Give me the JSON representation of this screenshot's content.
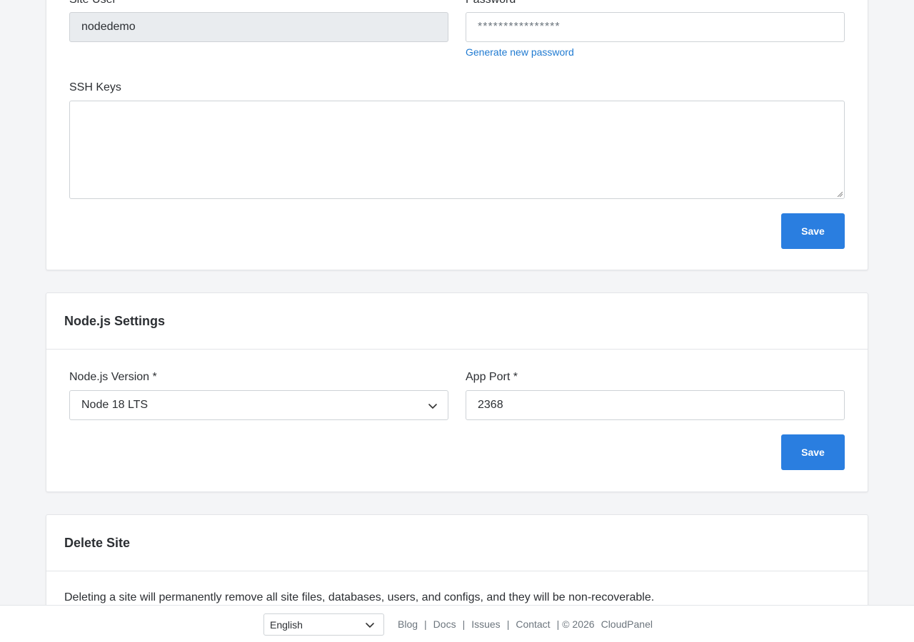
{
  "site_user_section": {
    "site_user_label": "Site User",
    "site_user_value": "nodedemo",
    "password_label": "Password",
    "password_placeholder": "****************",
    "generate_password_link": "Generate new password",
    "ssh_keys_label": "SSH Keys",
    "ssh_keys_value": "",
    "save_label": "Save"
  },
  "nodejs_settings": {
    "title": "Node.js Settings",
    "version_label": "Node.js Version *",
    "version_selected": "Node 18 LTS",
    "app_port_label": "App Port *",
    "app_port_value": "2368",
    "save_label": "Save"
  },
  "delete_site": {
    "title": "Delete Site",
    "description": "Deleting a site will permanently remove all site files, databases, users, and configs, and they will be non-recoverable."
  },
  "footer": {
    "language_selected": "English",
    "links": [
      "Blog",
      "Docs",
      "Issues",
      "Contact"
    ],
    "copyright": "© 2026",
    "brand": "CloudPanel"
  },
  "icons": {
    "select_chevron": "chevron-down-icon",
    "textarea_resize": "resize-grip-icon"
  },
  "colors": {
    "primary": "#2a7ee0",
    "link": "#1f7ad1",
    "page_background": "#f4f5f7"
  }
}
